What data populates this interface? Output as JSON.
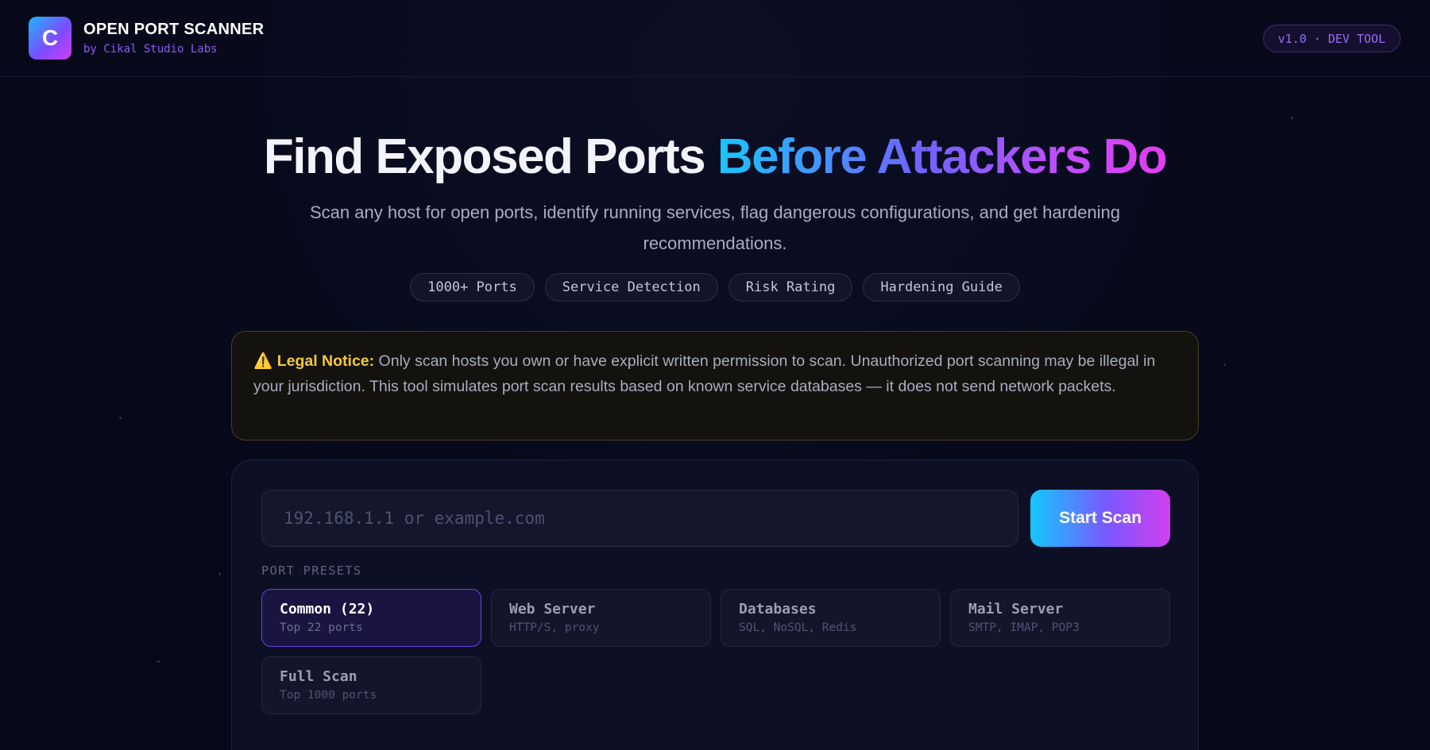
{
  "header": {
    "logo_letter": "C",
    "title": "OPEN PORT SCANNER",
    "subtitle": "by Cikal Studio Labs",
    "version_badge": "v1.0 · DEV TOOL"
  },
  "hero": {
    "title_plain": "Find Exposed Ports ",
    "title_gradient": "Before Attackers Do",
    "subtitle": "Scan any host for open ports, identify running services, flag dangerous configurations, and get hardening recommendations.",
    "pills": [
      "1000+ Ports",
      "Service Detection",
      "Risk Rating",
      "Hardening Guide"
    ]
  },
  "notice": {
    "icon": "⚠️",
    "label": "Legal Notice:",
    "text": " Only scan hosts you own or have explicit written permission to scan. Unauthorized port scanning may be illegal in your jurisdiction. This tool simulates port scan results based on known service databases — it does not send network packets."
  },
  "scan": {
    "input_placeholder": "192.168.1.1 or example.com",
    "input_value": "",
    "start_label": "Start Scan",
    "presets_label": "PORT PRESETS",
    "presets": [
      {
        "name": "Common (22)",
        "desc": "Top 22 ports",
        "selected": true
      },
      {
        "name": "Web Server",
        "desc": "HTTP/S, proxy",
        "selected": false
      },
      {
        "name": "Databases",
        "desc": "SQL, NoSQL, Redis",
        "selected": false
      },
      {
        "name": "Mail Server",
        "desc": "SMTP, IMAP, POP3",
        "selected": false
      },
      {
        "name": "Full Scan",
        "desc": "Top 1000 ports",
        "selected": false
      }
    ]
  },
  "colors": {
    "background": "#07091a",
    "accent_cyan": "#19c6ff",
    "accent_purple": "#7a58ff",
    "accent_magenta": "#d43cf0",
    "warning": "#f5c938"
  }
}
